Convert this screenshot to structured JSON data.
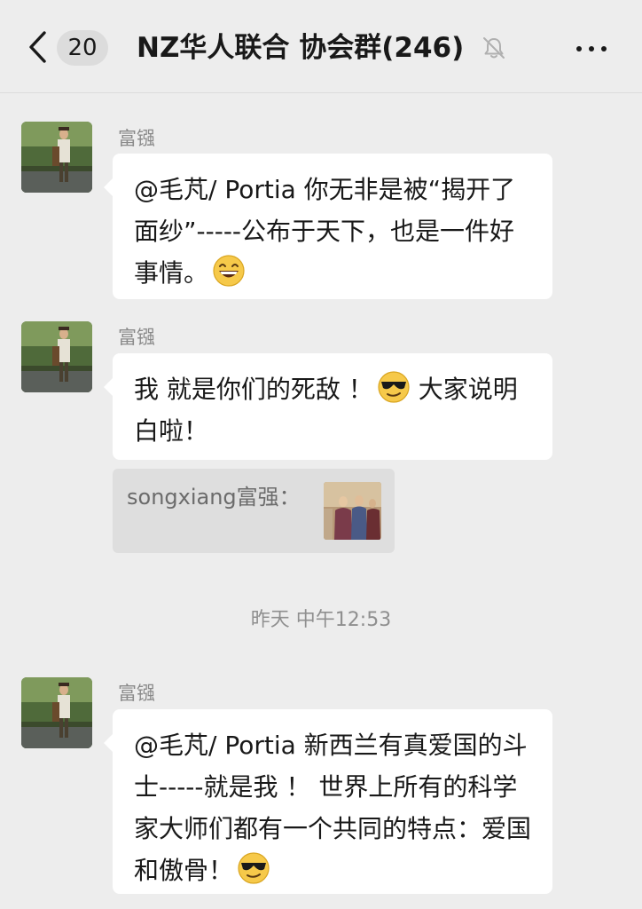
{
  "header": {
    "unread_count": "20",
    "title": "NZ华人联合 协会群(246)"
  },
  "messages": [
    {
      "sender": "富镪",
      "text": "@毛芃/ Portia  你无非是被“揭开了面纱”-----公布于天下，也是一件好事情。",
      "emoji": "grinning-face-emoji"
    },
    {
      "sender": "富镪",
      "text": "我 就是你们的死敌 ！",
      "emoji": "sunglasses-face-emoji",
      "text_after": "大家说明白啦！"
    },
    {
      "sender": "富镪",
      "text": "@毛芃/ Portia  新西兰有真爱国的斗士-----就是我 ！ 世界上所有的科学家大师们都有一个共同的特点：爱国和傲骨！",
      "emoji": "sunglasses-face-emoji"
    }
  ],
  "quote": {
    "text": "songxiang富强："
  },
  "timestamp": "昨天 中午12:53",
  "colors": {
    "background": "#ededed",
    "bubble": "#ffffff",
    "quote": "#dedede",
    "secondary_text": "#8a8a8a"
  }
}
